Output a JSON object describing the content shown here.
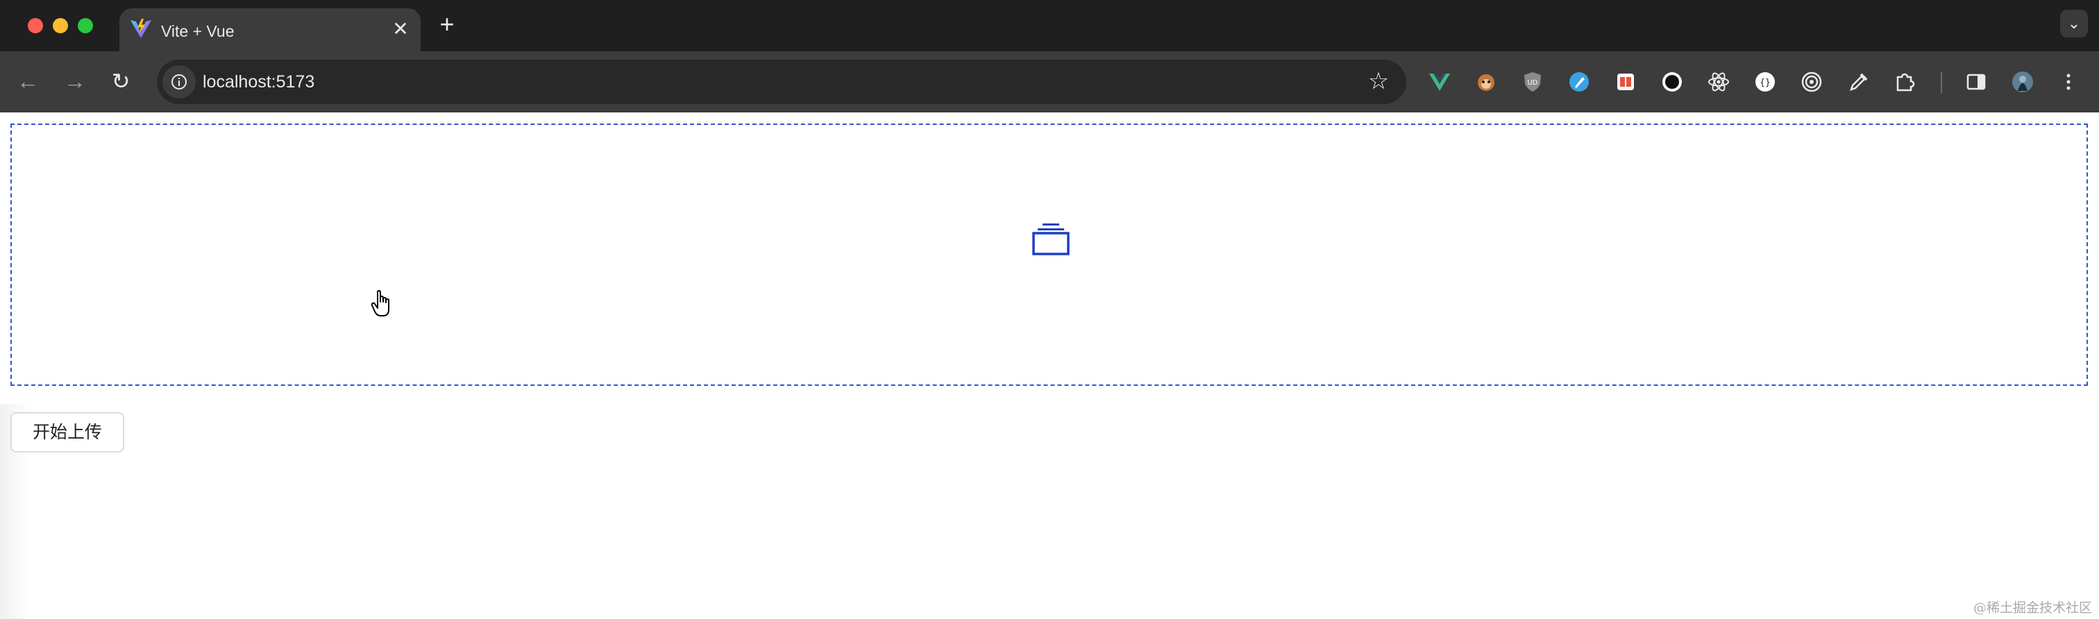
{
  "browser": {
    "tab": {
      "title": "Vite + Vue",
      "close_glyph": "✕"
    },
    "new_tab_glyph": "+",
    "tab_search_glyph": "⌄",
    "address": {
      "url": "localhost:5173"
    },
    "nav": {
      "back_glyph": "←",
      "forward_glyph": "→",
      "reload_glyph": "↻"
    },
    "bookmark_glyph": "☆",
    "extensions": [
      "vue-devtools-icon",
      "tampermonkey-icon",
      "ublock-icon",
      "pen-icon",
      "translate-icon",
      "circle-icon",
      "react-devtools-icon",
      "json-viewer-icon",
      "target-icon",
      "color-picker-icon",
      "puzzle-icon",
      "side-panel-icon",
      "profile-avatar-icon"
    ]
  },
  "page": {
    "upload_button_label": "开始上传",
    "watermark": "@稀土掘金技术社区"
  },
  "colors": {
    "dropzone_border": "#2f54d4",
    "upload_icon": "#1d3fc4",
    "tabstrip_bg": "#1f1f1f",
    "toolbar_bg": "#3c3c3c"
  }
}
